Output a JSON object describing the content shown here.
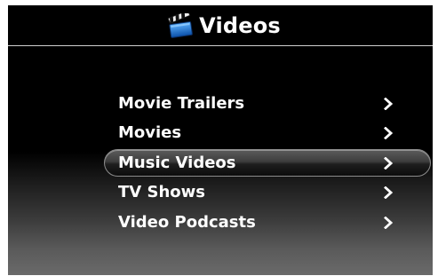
{
  "header": {
    "title": "Videos",
    "icon": "clapperboard-icon"
  },
  "menu": {
    "items": [
      {
        "label": "Movie Trailers",
        "selected": false
      },
      {
        "label": "Movies",
        "selected": false
      },
      {
        "label": "Music Videos",
        "selected": true
      },
      {
        "label": "TV Shows",
        "selected": false
      },
      {
        "label": "Video Podcasts",
        "selected": false
      }
    ]
  },
  "colors": {
    "background": "#000000",
    "text": "#ffffff",
    "clapper_blue": "#1e7fd8"
  }
}
